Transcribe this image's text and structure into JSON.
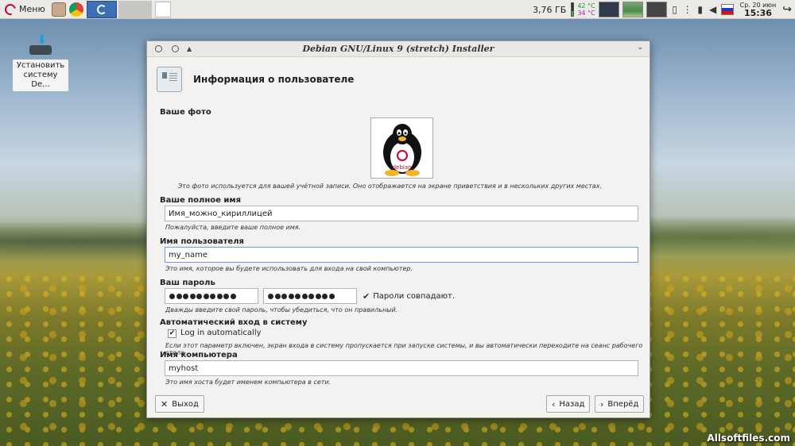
{
  "panel": {
    "menu_label": "Меню",
    "disk_usage": "3,76 ГБ",
    "temp1": "42 °C",
    "temp2": "34 °C",
    "date": "Ср. 20 июн",
    "time": "15:36"
  },
  "desktop_icon": {
    "label": "Установить систему De..."
  },
  "window": {
    "title": "Debian GNU/Linux 9 (stretch) Installer",
    "page_title": "Информация о пользователе",
    "photo": {
      "label": "Ваше фото",
      "hint": "Это фото используется для вашей учётной записи. Оно отображается на экране приветствия и в нескольких других местах.",
      "logo_text": "debian"
    },
    "full_name": {
      "label": "Ваше полное имя",
      "value": "Имя_можно_кириллицей",
      "hint": "Пожалуйста, введите ваше полное имя."
    },
    "username": {
      "label": "Имя пользователя",
      "value": "my_name",
      "hint": "Это имя, которое вы будете использовать для входа на свой компьютер."
    },
    "password": {
      "label": "Ваш пароль",
      "dots1": 10,
      "dots2": 10,
      "match_text": "Пароли совпадают.",
      "hint": "Дважды введите свой пароль, чтобы убедиться, что он правильный."
    },
    "autologin": {
      "label": "Автоматический вход в систему",
      "checkbox_label": "Log in automatically",
      "checked": true,
      "hint": "Если этот параметр включен, экран входа в систему пропускается при запуске системы, и вы автоматически переходите на сеанс рабочего стола."
    },
    "hostname": {
      "label": "Имя компьютера",
      "value": "myhost",
      "hint": "Это имя хоста будет именем компьютера в сети."
    },
    "buttons": {
      "exit": "Выход",
      "back": "Назад",
      "next": "Вперёд"
    }
  },
  "watermark": "Allsoftfiles.com"
}
